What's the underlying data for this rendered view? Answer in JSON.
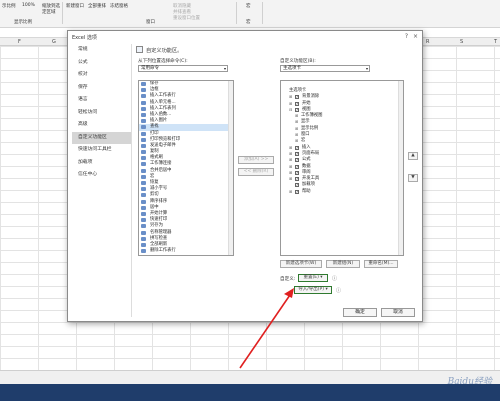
{
  "ribbon": {
    "items": [
      "示比例",
      "100%",
      "缩放到选定区域",
      "新建窗口",
      "全部重排",
      "冻结窗格",
      "取消隐藏",
      "并排查看",
      "重设窗口位置",
      "宏"
    ],
    "group_labels": [
      "显示比例",
      "窗口",
      "宏"
    ]
  },
  "columns": [
    "F",
    "G",
    "H",
    "I",
    "J",
    "K",
    "L",
    "M",
    "N",
    "O",
    "P",
    "Q",
    "R",
    "S",
    "T"
  ],
  "dialog": {
    "title": "Excel 选项",
    "help": "?",
    "close": "×",
    "nav": [
      "常规",
      "公式",
      "校对",
      "保存",
      "语言",
      "轻松访问",
      "高级",
      "自定义功能区",
      "快速访问工具栏",
      "加载项",
      "信任中心"
    ],
    "nav_active_index": 7,
    "heading": "自定义功能区。",
    "left_label": "从下列位置选择命令(C):",
    "left_combo": "常用命令",
    "right_label": "自定义功能区(B):",
    "right_combo": "主选项卡",
    "commands": [
      "保存",
      "边框",
      "插入工作表行",
      "插入单元格...",
      "插入工作表列",
      "插入函数...",
      "插入图片",
      "查找",
      "打印",
      "打印预览和打印",
      "发送电子邮件",
      "复制",
      "格式刷",
      "工作簿连接",
      "合并后居中",
      "宏",
      "恢复",
      "减小字号",
      "剪切",
      "降序排序",
      "居中",
      "开始计算",
      "快速打印",
      "另存为",
      "名称管理器",
      "拼写检查",
      "全部刷新",
      "删除工作表行"
    ],
    "commands_selected_index": 7,
    "add_button": "添加(A) >>",
    "remove_button": "<< 删除(R)",
    "tree": [
      {
        "label": "主选项卡",
        "indent": 0,
        "expand": "",
        "checked": null
      },
      {
        "label": "背景消除",
        "indent": 1,
        "expand": "⊞",
        "checked": true
      },
      {
        "label": "开始",
        "indent": 1,
        "expand": "⊞",
        "checked": true
      },
      {
        "label": "视图",
        "indent": 1,
        "expand": "⊟",
        "checked": true
      },
      {
        "label": "工作簿视图",
        "indent": 2,
        "expand": "⊞",
        "checked": null
      },
      {
        "label": "显示",
        "indent": 2,
        "expand": "⊞",
        "checked": null
      },
      {
        "label": "显示比例",
        "indent": 2,
        "expand": "⊞",
        "checked": null
      },
      {
        "label": "窗口",
        "indent": 2,
        "expand": "⊞",
        "checked": null
      },
      {
        "label": "宏",
        "indent": 2,
        "expand": "⊞",
        "checked": null
      },
      {
        "label": "插入",
        "indent": 1,
        "expand": "⊞",
        "checked": true
      },
      {
        "label": "页面布局",
        "indent": 1,
        "expand": "⊞",
        "checked": true
      },
      {
        "label": "公式",
        "indent": 1,
        "expand": "⊞",
        "checked": true
      },
      {
        "label": "数据",
        "indent": 1,
        "expand": "⊞",
        "checked": true
      },
      {
        "label": "审阅",
        "indent": 1,
        "expand": "⊞",
        "checked": true
      },
      {
        "label": "开发工具",
        "indent": 1,
        "expand": "⊞",
        "checked": true
      },
      {
        "label": "加载项",
        "indent": 1,
        "expand": "",
        "checked": true
      },
      {
        "label": "帮助",
        "indent": 1,
        "expand": "⊞",
        "checked": true
      }
    ],
    "new_tab": "新建选项卡(W)",
    "new_group": "新建组(N)",
    "rename": "重命名(M)...",
    "custom_label": "自定义:",
    "reset_button": "重置(E) ▾",
    "import_export": "导入/导出(P) ▾",
    "ok": "确定",
    "cancel": "取消"
  },
  "watermark": "Baidu经验",
  "colors": {
    "accent_arrow": "#e02020",
    "taskbar": "#1f3d6b",
    "selection": "#cfe3f7"
  }
}
